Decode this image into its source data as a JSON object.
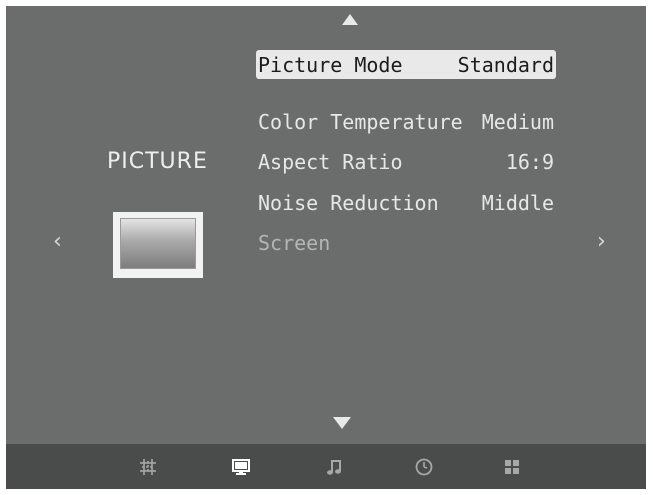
{
  "section": {
    "title": "PICTURE",
    "icon": "tv-icon"
  },
  "menu": {
    "items": [
      {
        "label": "Picture Mode",
        "value": "Standard",
        "state": "selected"
      },
      {
        "label": "Color Temperature",
        "value": "Medium",
        "state": "normal"
      },
      {
        "label": "Aspect Ratio",
        "value": "16:9",
        "state": "normal"
      },
      {
        "label": "Noise Reduction",
        "value": "Middle",
        "state": "normal"
      },
      {
        "label": "Screen",
        "value": "",
        "state": "disabled"
      }
    ]
  },
  "navigation": {
    "up": "triangle-up-icon",
    "down": "triangle-down-icon",
    "left": "chevron-left-icon",
    "right": "chevron-right-icon",
    "left_glyph": "‹",
    "right_glyph": "›"
  },
  "tabs": [
    {
      "name": "channel-tab",
      "icon": "channel-icon",
      "active": false
    },
    {
      "name": "picture-tab",
      "icon": "monitor-icon",
      "active": true
    },
    {
      "name": "sound-tab",
      "icon": "music-note-icon",
      "active": false
    },
    {
      "name": "time-tab",
      "icon": "clock-icon",
      "active": false
    },
    {
      "name": "option-tab",
      "icon": "grid-icon",
      "active": false
    }
  ],
  "colors": {
    "background": "#6b6d6d",
    "bottom_bar": "#4a4b4b",
    "highlight": "#e9e9e9",
    "text": "#e7e7e7",
    "disabled_text": "#b4b6b6",
    "active_tab_icon": "#ffffff",
    "inactive_tab_icon": "#a6a8a8"
  }
}
